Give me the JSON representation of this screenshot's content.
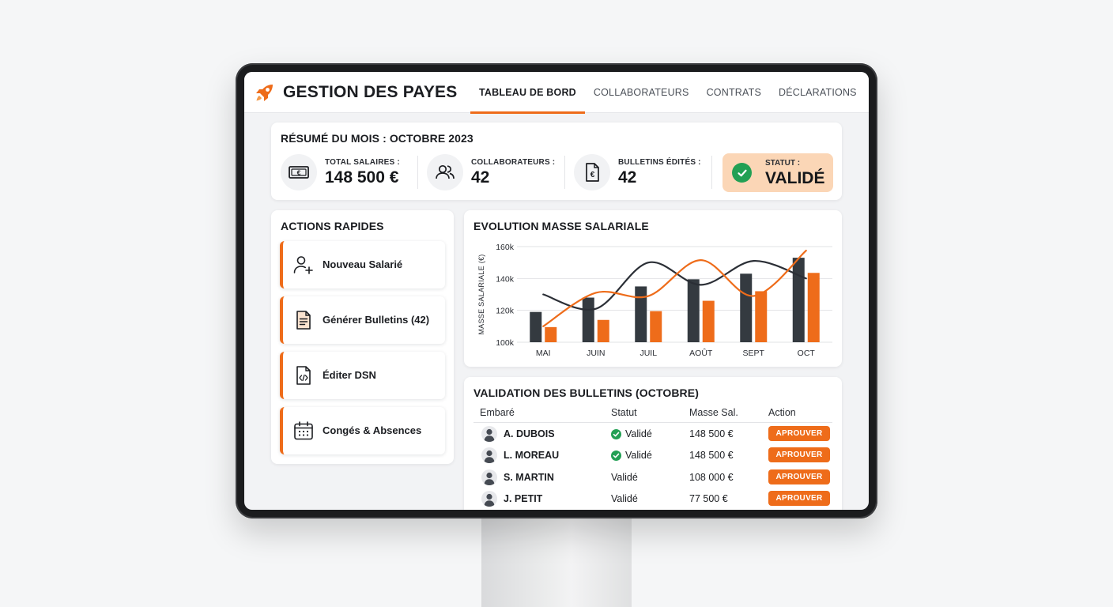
{
  "app": {
    "title": "GESTION DES PAYES",
    "logo_icon": "rocket-icon"
  },
  "nav": {
    "tabs": [
      {
        "label": "TABLEAU DE BORD",
        "active": true
      },
      {
        "label": "COLLABORATEURS",
        "active": false
      },
      {
        "label": "CONTRATS",
        "active": false
      },
      {
        "label": "DÉCLARATIONS",
        "active": false
      }
    ]
  },
  "summary": {
    "title": "RÉSUMÉ DU MOIS : OCTOBRE 2023",
    "kpis": [
      {
        "label": "TOTAL SALAIRES :",
        "value": "148 500 €",
        "icon": "banknote-icon"
      },
      {
        "label": "COLLABORATEURS :",
        "value": "42",
        "icon": "users-icon"
      },
      {
        "label": "BULLETINS ÉDITÉS :",
        "value": "42",
        "icon": "payslip-icon"
      }
    ],
    "status": {
      "label": "STATUT :",
      "value": "VALIDÉ",
      "icon": "check-circle-icon"
    }
  },
  "actions": {
    "title": "ACTIONS RAPIDES",
    "items": [
      {
        "label": "Nouveau Salarié",
        "icon": "user-plus-icon"
      },
      {
        "label": "Générer Bulletins (42)",
        "icon": "document-icon"
      },
      {
        "label": "Éditer DSN",
        "icon": "code-file-icon"
      },
      {
        "label": "Congés & Absences",
        "icon": "calendar-icon"
      }
    ]
  },
  "chart_data": {
    "type": "bar",
    "title": "EVOLUTION MASSE SALARIALE",
    "ylabel": "MASSE SALARIALE (€)",
    "xlabel": "",
    "categories": [
      "MAI",
      "JUIN",
      "JUIL",
      "AOÛT",
      "SEPT",
      "OCT"
    ],
    "ylim": [
      100000,
      160000
    ],
    "yticks": [
      100000,
      120000,
      140000,
      160000
    ],
    "ytick_labels": [
      "100k",
      "120k",
      "140k",
      "160k"
    ],
    "grid": true,
    "series": [
      {
        "kind": "bar",
        "color": "#343a40",
        "values": [
          119000,
          128000,
          135000,
          139500,
          143000,
          153000
        ]
      },
      {
        "kind": "bar",
        "color": "#ee6c1a",
        "values": [
          109500,
          114000,
          119500,
          126000,
          132000,
          143500
        ]
      },
      {
        "kind": "line",
        "color": "#2b2f36",
        "values": [
          130000,
          121000,
          150000,
          136000,
          151000,
          140000
        ]
      },
      {
        "kind": "line",
        "color": "#ee6c1a",
        "values": [
          110000,
          131000,
          129000,
          151500,
          129000,
          157500
        ]
      }
    ]
  },
  "validation": {
    "title": "VALIDATION DES BULLETINS (OCTOBRE)",
    "columns": [
      "Embaré",
      "Statut",
      "Masse Sal.",
      "Action"
    ],
    "rows": [
      {
        "name": "A. DUBOIS",
        "status": "Validé",
        "status_icon": true,
        "amount": "148 500 €",
        "action": "APROUVER"
      },
      {
        "name": "L. MOREAU",
        "status": "Validé",
        "status_icon": true,
        "amount": "148 500 €",
        "action": "APROUVER"
      },
      {
        "name": "S. MARTIN",
        "status": "Validé",
        "status_icon": false,
        "amount": "108 000 €",
        "action": "APROUVER"
      },
      {
        "name": "J. PETIT",
        "status": "Validé",
        "status_icon": false,
        "amount": "77 500 €",
        "action": "APROUVER"
      }
    ]
  },
  "colors": {
    "accent": "#ee6c1a",
    "dark": "#343a40",
    "success": "#22a054",
    "status_bg": "#fbd6b6"
  }
}
